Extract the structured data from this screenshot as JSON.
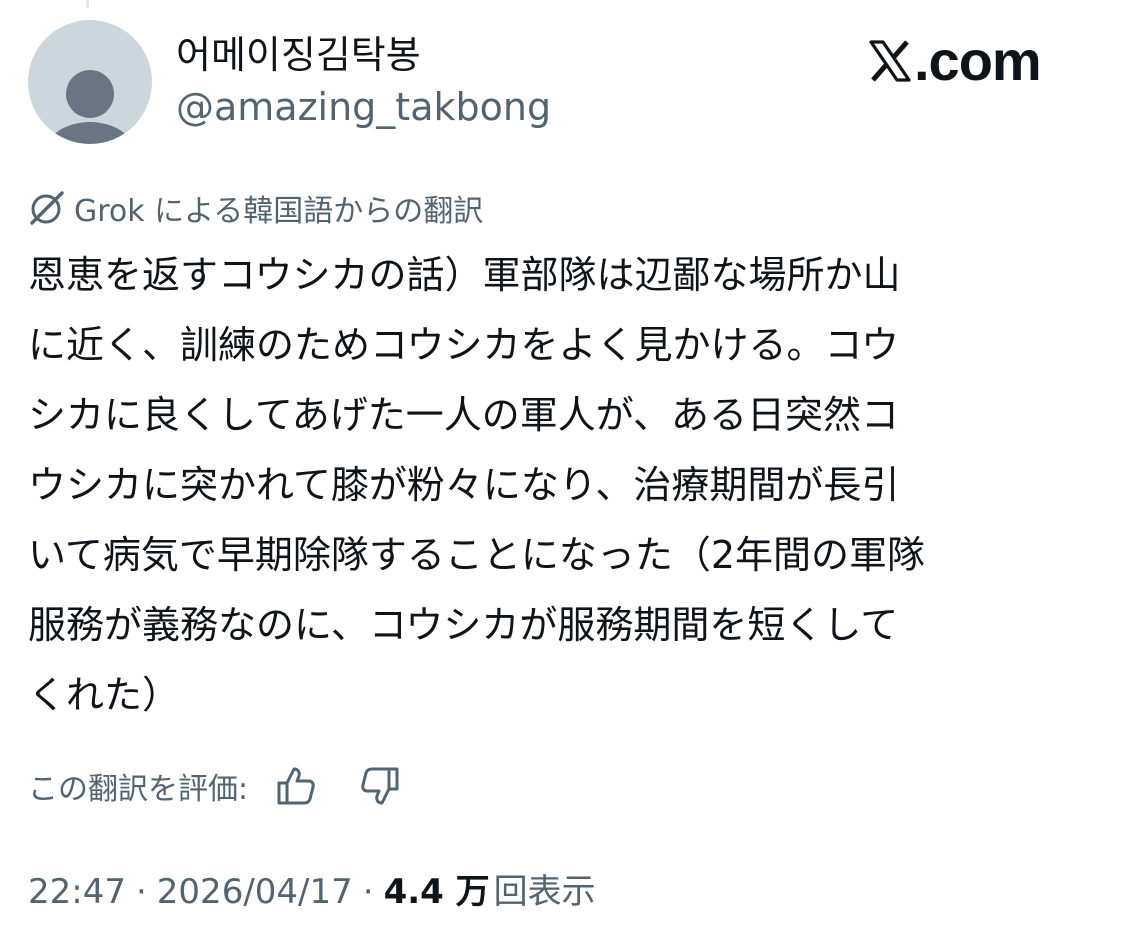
{
  "author": {
    "display_name": "어메이징김탁봉",
    "handle": "@amazing_takbong",
    "avatar_icon": "default-avatar-icon"
  },
  "brand": {
    "logo_text": ".com",
    "logo_icon": "x-logo-icon"
  },
  "translation": {
    "icon": "grok-icon",
    "label": "Grok による韓国語からの翻訳"
  },
  "post": {
    "lines": [
      "恩恵を返すコウシカの話）軍部隊は辺鄙な場所か山",
      "に近く、訓練のためコウシカをよく見かける。コウ",
      "シカに良くしてあげた一人の軍人が、ある日突然コ",
      "ウシカに突かれて膝が粉々になり、治療期間が長引",
      "いて病気で早期除隊することになった（2年間の軍隊",
      "服務が義務なのに、コウシカが服務期間を短くして",
      "くれた）"
    ]
  },
  "rating": {
    "label": "この翻訳を評価:",
    "thumbs_up_icon": "thumbs-up-icon",
    "thumbs_down_icon": "thumbs-down-icon"
  },
  "meta": {
    "time": "22:47",
    "separator": "·",
    "date": "2026/04/17",
    "views_count": "4.4 万",
    "views_label": "回表示"
  },
  "colors": {
    "text_primary": "#0f1419",
    "text_secondary": "#536471",
    "avatar_bg": "#ccd6dd",
    "avatar_figure": "#687684"
  }
}
